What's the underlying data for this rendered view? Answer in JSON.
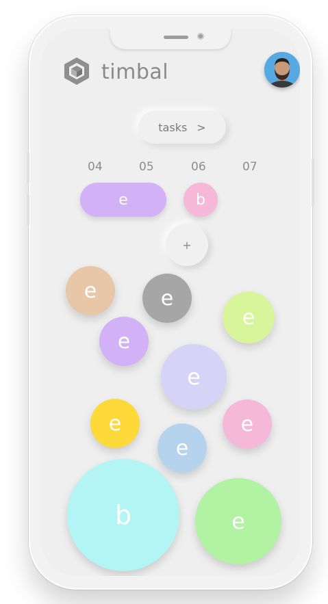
{
  "app": {
    "name": "timbal"
  },
  "header": {
    "avatar_alt": "user avatar"
  },
  "tasks_button": {
    "label": "tasks",
    "chevron": ">"
  },
  "days": [
    "04",
    "05",
    "06",
    "07"
  ],
  "scheduled": [
    {
      "letter": "e",
      "color": "#d3b1f6"
    },
    {
      "letter": "b",
      "color": "#f5b8d9"
    }
  ],
  "add_button": {
    "label": "+"
  },
  "bubbles": [
    {
      "letter": "e",
      "color": "#e8c6a8"
    },
    {
      "letter": "e",
      "color": "#a6a6a6"
    },
    {
      "letter": "e",
      "color": "#d8f59c"
    },
    {
      "letter": "e",
      "color": "#d3b1f6"
    },
    {
      "letter": "e",
      "color": "#d6d4f6"
    },
    {
      "letter": "e",
      "color": "#fdd93a"
    },
    {
      "letter": "e",
      "color": "#f5b8d9"
    },
    {
      "letter": "e",
      "color": "#b6d3ee"
    },
    {
      "letter": "b",
      "color": "#b3f4f4"
    },
    {
      "letter": "e",
      "color": "#b2f2a3"
    }
  ]
}
